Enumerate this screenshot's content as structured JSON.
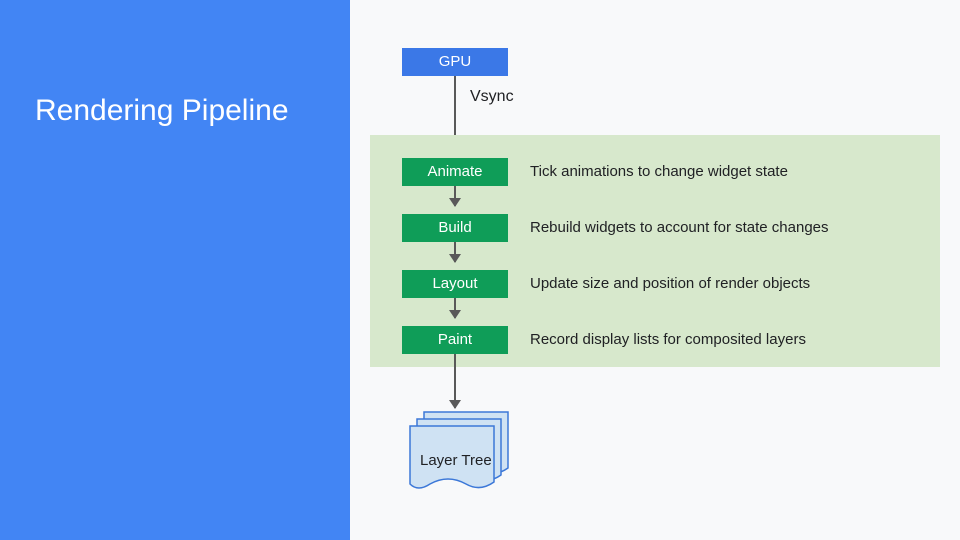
{
  "sidebar": {
    "title": "Rendering Pipeline"
  },
  "gpu": {
    "label": "GPU"
  },
  "vsync": {
    "label": "Vsync"
  },
  "stages": [
    {
      "name": "Animate",
      "desc": "Tick animations to change widget state"
    },
    {
      "name": "Build",
      "desc": "Rebuild widgets to account for state changes"
    },
    {
      "name": "Layout",
      "desc": "Update size and position of render objects"
    },
    {
      "name": "Paint",
      "desc": "Record display lists for composited layers"
    }
  ],
  "output": {
    "label": "Layer Tree"
  },
  "colors": {
    "sidebar": "#4285f4",
    "gpu_box": "#3b78e7",
    "stage_box": "#0f9d58",
    "panel": "#d7e8cc",
    "doc_fill": "#cfe2f3",
    "doc_stroke": "#3c78d8"
  }
}
